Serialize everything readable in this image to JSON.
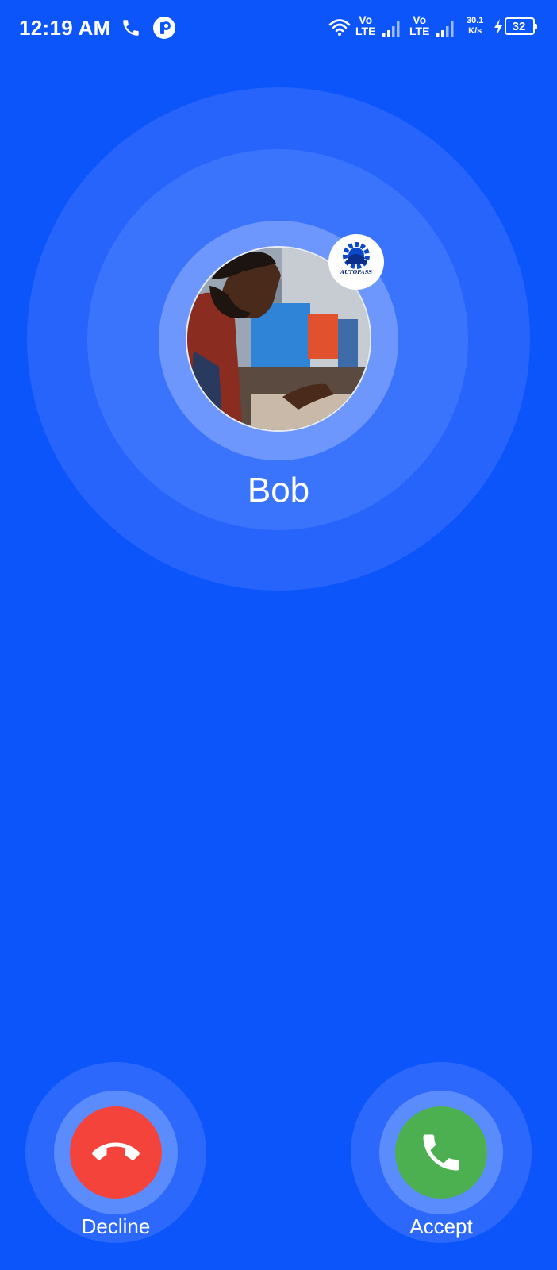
{
  "status_bar": {
    "time": "12:19 AM",
    "sim1": {
      "vo": "Vo",
      "lte": "LTE"
    },
    "sim2": {
      "vo": "Vo",
      "lte": "LTE"
    },
    "net_speed_value": "30.1",
    "net_speed_unit": "K/s",
    "battery_level": "32",
    "charging": true,
    "icons": [
      "phone-icon",
      "app-notification-icon",
      "wifi-icon",
      "signal-icon",
      "charging-icon",
      "battery-icon"
    ]
  },
  "call": {
    "caller_name": "Bob",
    "badge_text": "AUTOPASS"
  },
  "actions": {
    "decline_label": "Decline",
    "accept_label": "Accept"
  },
  "colors": {
    "background": "#0b55fb",
    "decline": "#f4433a",
    "accept": "#4caf50"
  }
}
